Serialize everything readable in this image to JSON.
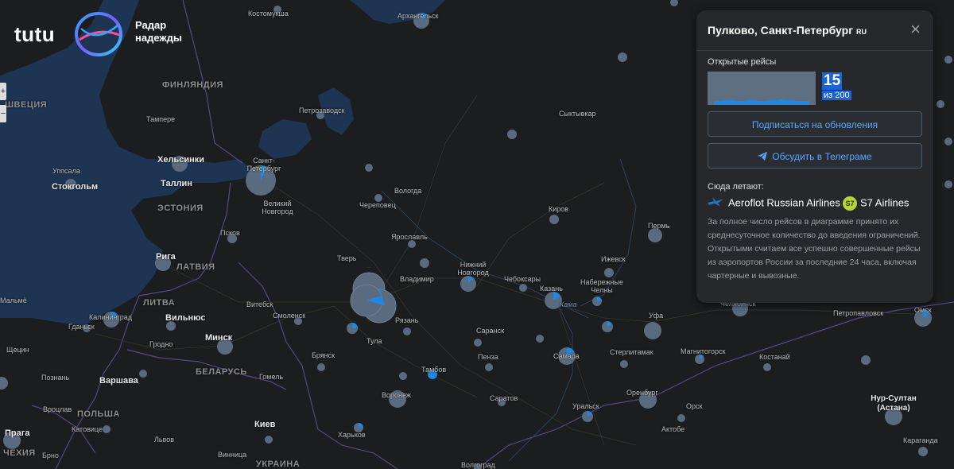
{
  "app": {
    "logo_text": "tutu",
    "tagline": "Радар надежды",
    "zoom_in": "+",
    "zoom_out": "−"
  },
  "panel": {
    "title": "Пулково, Санкт-Петербург",
    "country_code": "RU",
    "close_icon": "×",
    "open_flights_label": "Открытые рейсы",
    "open_flights_count": "15",
    "total_flights": "из 200",
    "subscribe_button": "Подписаться на обновления",
    "telegram_button": "Обсудить в Телеграме",
    "telegram_icon": "telegram-plane-icon",
    "flying_here_label": "Сюда летают:",
    "airlines": [
      {
        "name": "Aeroflot Russian Airlines",
        "icon": "aeroflot-logo-icon"
      },
      {
        "name": "S7 Airlines",
        "icon": "s7-logo-icon",
        "badge": "S7"
      }
    ],
    "note": "За полное число рейсов в диаграмме принято их среднесуточное количество до введения ограничений. Открытыми считаем все успешно совершенные рейсы из аэропортов России за последние 24 часа, включая чартерные и вывозные."
  },
  "colors": {
    "background": "#1b1d1f",
    "water": "#1d3452",
    "marker": "#5a6b80",
    "accent": "#1e88e5",
    "panel": "#26282c"
  },
  "map": {
    "countries": [
      "ФИНЛЯНДИЯ",
      "ШВЕЦИЯ",
      "ЭСТОНИЯ",
      "ЛАТВИЯ",
      "ЛИТВА",
      "БЕЛАРУСЬ",
      "ПОЛЬША",
      "УКРАИНА",
      "ЧЕХИЯ"
    ],
    "cities": [
      "Костомукша",
      "Архангельск",
      "Петрозаводск",
      "Тампере",
      "Хельсинки",
      "Санкт-Петербург",
      "Уппсала",
      "Стокгольм",
      "Таллин",
      "Великий Новгород",
      "Вологда",
      "Череповец",
      "Сыктывкар",
      "Киров",
      "Пермь",
      "Псков",
      "Ярославль",
      "Тверь",
      "Рига",
      "Нижний Новгород",
      "Чебоксары",
      "Ижевск",
      "Владимир",
      "Казань",
      "Набережные Челны",
      "Витебск",
      "Смоленск",
      "Калининград",
      "Вильнюс",
      "Рязань",
      "Уфа",
      "Гданьск",
      "Гродно",
      "Минск",
      "Тула",
      "Саранск",
      "Челябинск",
      "Омск",
      "Петропавловск",
      "Щецин",
      "Брянск",
      "Пенза",
      "Самара",
      "Стерлитамак",
      "Магнитогорск",
      "Костанай",
      "Познань",
      "Варшава",
      "Гомель",
      "Тамбов",
      "Воронеж",
      "Саратов",
      "Оренбург",
      "Уральск",
      "Орск",
      "Нур-Султан (Астана)",
      "Вроцлав",
      "Катовице",
      "Киев",
      "Харьков",
      "Актобе",
      "Прага",
      "Брно",
      "Львов",
      "Винница",
      "Волгоград",
      "Караганда",
      "Мальмё",
      "Кама"
    ]
  }
}
